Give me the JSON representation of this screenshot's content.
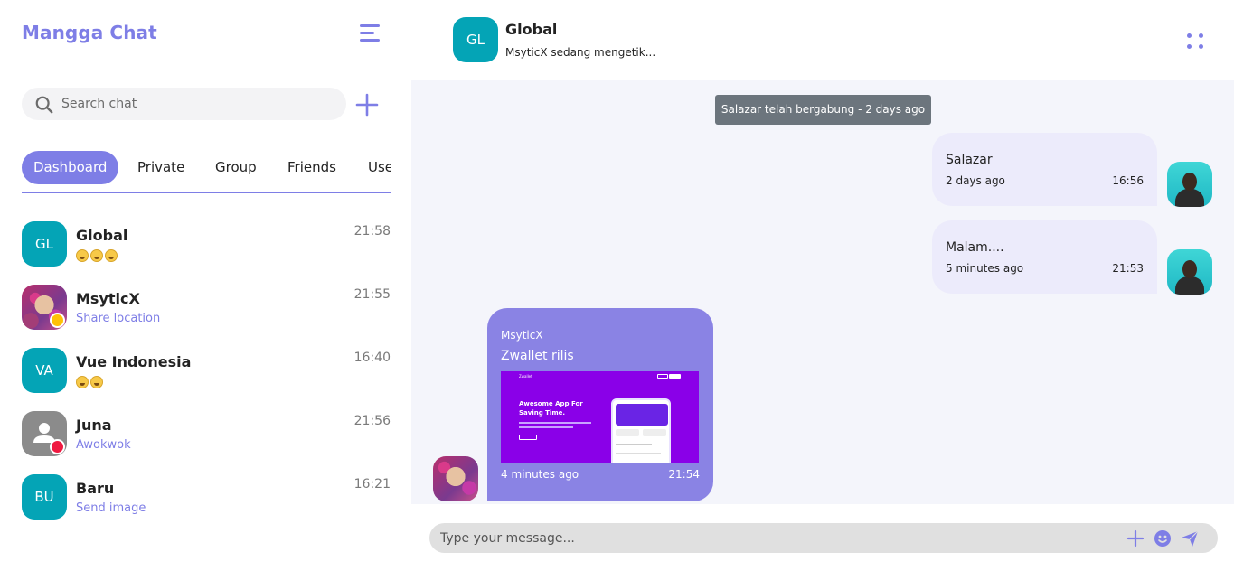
{
  "sidebar": {
    "brand": "Mangga Chat",
    "search": {
      "placeholder": "Search chat"
    },
    "tabs": [
      {
        "label": "Dashboard",
        "active": true
      },
      {
        "label": "Private"
      },
      {
        "label": "Group"
      },
      {
        "label": "Friends"
      },
      {
        "label": "Users"
      }
    ],
    "chats": [
      {
        "initials": "GL",
        "name": "Global",
        "preview": "",
        "emoji_count": 3,
        "time": "21:58"
      },
      {
        "initials": "",
        "name": "MsyticX",
        "preview": "Share location",
        "time": "21:55",
        "status_color": "#ffc107"
      },
      {
        "initials": "VA",
        "name": "Vue Indonesia",
        "preview": "",
        "emoji_count": 2,
        "time": "16:40"
      },
      {
        "initials": "",
        "name": "Juna",
        "preview": "Awokwok",
        "time": "21:56",
        "status_color": "#ef1a41"
      },
      {
        "initials": "BU",
        "name": "Baru",
        "preview": "Send image",
        "time": "16:21"
      }
    ]
  },
  "header": {
    "initials": "GL",
    "title": "Global",
    "status": "MsyticX sedang mengetik..."
  },
  "messages": {
    "system": "Salazar telah bergabung - 2 days ago",
    "outgoing": [
      {
        "text": "Salazar",
        "ago": "2 days ago",
        "time": "16:56"
      },
      {
        "text": "Malam....",
        "ago": "5 minutes ago",
        "time": "21:53"
      }
    ],
    "incoming": {
      "sender": "MsyticX",
      "text": "Zwallet rilis",
      "ago": "4 minutes ago",
      "time": "21:54",
      "image": {
        "brand": "Zwallet",
        "headline_1": "Awesome App For",
        "headline_2": "Saving Time."
      }
    }
  },
  "composer": {
    "placeholder": "Type your message..."
  },
  "colors": {
    "accent": "#7e7ee6",
    "teal": "#04a4b6",
    "chat_bg": "#f4f5fb",
    "bubble_in": "#8a83e4",
    "bubble_out": "#ecebfb"
  }
}
